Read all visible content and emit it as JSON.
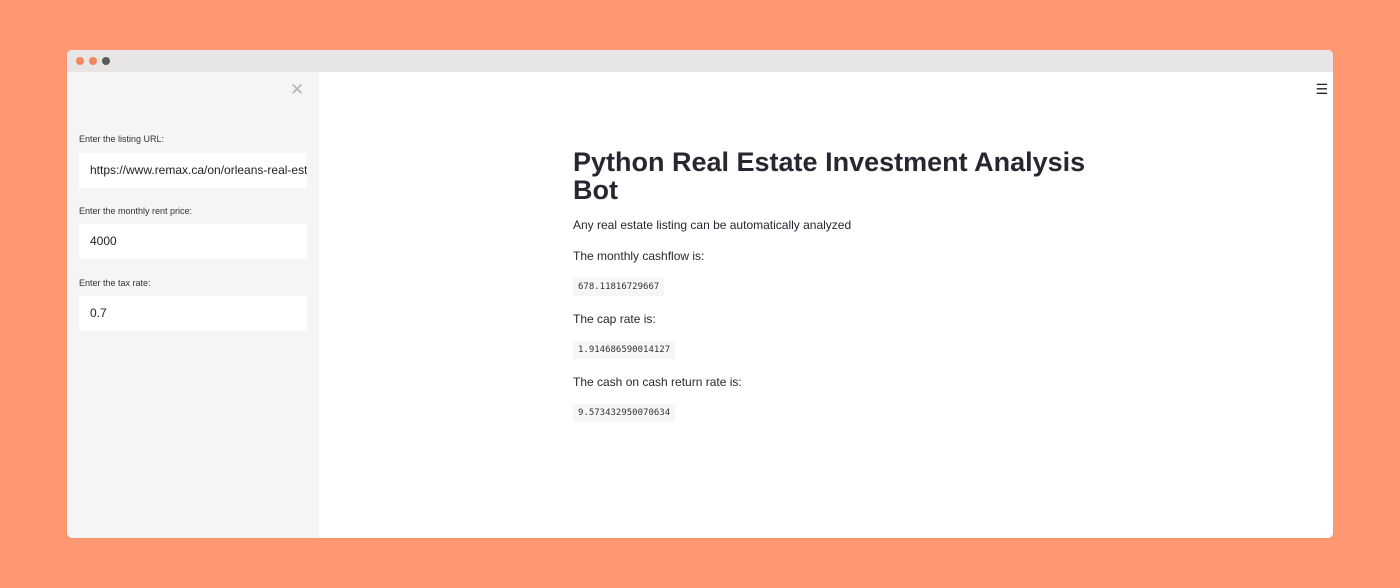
{
  "sidebar": {
    "close_symbol": "✕",
    "fields": [
      {
        "label": "Enter the listing URL:",
        "value": "https://www.remax.ca/on/orleans-real-estate"
      },
      {
        "label": "Enter the monthly rent price:",
        "value": "4000"
      },
      {
        "label": "Enter the tax rate:",
        "value": "0.7"
      }
    ]
  },
  "header": {
    "menu_symbol": "☰"
  },
  "main": {
    "title": "Python Real Estate Investment Analysis Bot",
    "subtitle": "Any real estate listing can be automatically analyzed",
    "results": [
      {
        "label": "The monthly cashflow is:",
        "value": "678.11816729667"
      },
      {
        "label": "The cap rate is:",
        "value": "1.914686590014127"
      },
      {
        "label": "The cash on cash return rate is:",
        "value": "9.573432950070634"
      }
    ]
  },
  "colors": {
    "background": "#ff9870",
    "sidebar": "#f4f5f7",
    "text": "#262730"
  }
}
